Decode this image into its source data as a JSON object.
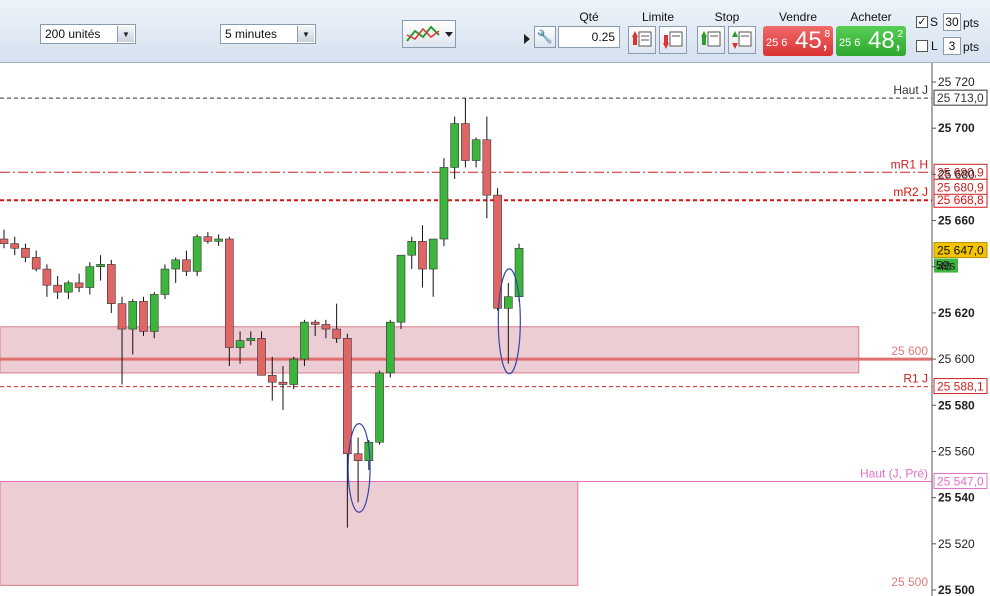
{
  "toolbar": {
    "units_select": "200 unités",
    "timeframe_select": "5 minutes",
    "qty_label": "Qté",
    "qty_value": "0.25",
    "limit_label": "Limite",
    "stop_label": "Stop",
    "sell_label": "Vendre",
    "buy_label": "Acheter",
    "sell_price_prefix": "25 6",
    "sell_price_main": "45,",
    "sell_price_sup": "8",
    "buy_price_prefix": "25 6",
    "buy_price_main": "48,",
    "buy_price_sup": "2",
    "stop_check_label": "S",
    "stop_pts_value": "30",
    "limit_check_label": "L",
    "limit_pts_value": "3",
    "pts_label": "pts"
  },
  "chart_data": {
    "type": "candlestick",
    "ylim": [
      25494,
      25730
    ],
    "yticks": [
      25720,
      25700,
      25680,
      25660,
      25640,
      25620,
      25600,
      25580,
      25560,
      25540,
      25520,
      25500
    ],
    "ytick_labels": [
      "25 720",
      "25 700",
      "25 680",
      "25 660",
      "40",
      "25 620",
      "25 600",
      "25 580",
      "25 560",
      "25 540",
      "25 520",
      "25 500"
    ],
    "candles": [
      [
        25652,
        25656,
        25648,
        25650
      ],
      [
        25650,
        25653,
        25645,
        25648
      ],
      [
        25648,
        25650,
        25642,
        25644
      ],
      [
        25644,
        25647,
        25638,
        25639
      ],
      [
        25639,
        25641,
        25627,
        25632
      ],
      [
        25632,
        25636,
        25626,
        25629
      ],
      [
        25629,
        25634,
        25626,
        25633
      ],
      [
        25633,
        25637,
        25629,
        25631
      ],
      [
        25631,
        25642,
        25628,
        25640
      ],
      [
        25640,
        25645,
        25634,
        25641
      ],
      [
        25641,
        25643,
        25620,
        25624
      ],
      [
        25624,
        25627,
        25589,
        25613
      ],
      [
        25613,
        25626,
        25602,
        25625
      ],
      [
        25625,
        25627,
        25610,
        25612
      ],
      [
        25612,
        25629,
        25609,
        25628
      ],
      [
        25628,
        25641,
        25626,
        25639
      ],
      [
        25639,
        25644,
        25633,
        25643
      ],
      [
        25643,
        25647,
        25636,
        25638
      ],
      [
        25638,
        25654,
        25636,
        25653
      ],
      [
        25653,
        25655,
        25650,
        25651
      ],
      [
        25651,
        25654,
        25649,
        25652
      ],
      [
        25652,
        25653,
        25597,
        25605
      ],
      [
        25605,
        25612,
        25598,
        25608
      ],
      [
        25608,
        25612,
        25606,
        25609
      ],
      [
        25609,
        25612,
        25593,
        25593
      ],
      [
        25593,
        25601,
        25582,
        25590
      ],
      [
        25590,
        25597,
        25578,
        25589
      ],
      [
        25589,
        25601,
        25587,
        25600
      ],
      [
        25600,
        25617,
        25597,
        25616
      ],
      [
        25616,
        25617,
        25610,
        25615
      ],
      [
        25615,
        25617,
        25609,
        25613
      ],
      [
        25613,
        25624,
        25607,
        25609
      ],
      [
        25609,
        25611,
        25527,
        25559
      ],
      [
        25559,
        25566,
        25538,
        25556
      ],
      [
        25556,
        25565,
        25552,
        25564
      ],
      [
        25564,
        25595,
        25563,
        25594
      ],
      [
        25594,
        25617,
        25592,
        25616
      ],
      [
        25616,
        25645,
        25613,
        25645
      ],
      [
        25645,
        25653,
        25639,
        25651
      ],
      [
        25651,
        25658,
        25631,
        25639
      ],
      [
        25639,
        25652,
        25627,
        25652
      ],
      [
        25652,
        25687,
        25649,
        25683
      ],
      [
        25683,
        25705,
        25678,
        25702
      ],
      [
        25702,
        25713,
        25683,
        25686
      ],
      [
        25686,
        25696,
        25683,
        25695
      ],
      [
        25695,
        25705,
        25661,
        25671
      ],
      [
        25671,
        25674,
        25621,
        25622
      ],
      [
        25622,
        25633,
        25598,
        25627
      ],
      [
        25627,
        25650,
        25625,
        25648
      ]
    ],
    "levels": [
      {
        "name": "Haut J",
        "value": 25713.0,
        "label": "25 713,0",
        "style": "dashed",
        "color": "#333333"
      },
      {
        "name": "mR1 H",
        "value": 25680.9,
        "label": "25 680,9",
        "style": "dashdot",
        "color": "#cc2222"
      },
      {
        "name": "mR2 J",
        "value": 25668.8,
        "label": "25 668,8",
        "style": "dashed",
        "color": "#dd1111"
      },
      {
        "name": "25 600",
        "value": 25600,
        "label": "",
        "style": "solid",
        "color": "#e07070"
      },
      {
        "name": "R1 J",
        "value": 25588.1,
        "label": "25 588,1",
        "style": "dashed",
        "color": "#cc2222"
      },
      {
        "name": "Haut (J, Pré)",
        "value": 25547.0,
        "label": "25 547,0",
        "style": "solid",
        "color": "#e070c8"
      }
    ],
    "extra_price_tag": "25 680,9",
    "current_price": {
      "value": 25647.0,
      "label": "25 647,0",
      "timer": "59s"
    },
    "zones": [
      {
        "from": 25594,
        "to": 25614,
        "x_end_fraction": 0.9
      },
      {
        "from": 25502,
        "to": 25547,
        "x_end_fraction": 0.62
      }
    ],
    "zone_label_upper": "25 600",
    "zone_label_lower": "25 500",
    "highlight_ellipses_at_candles": [
      33,
      47
    ],
    "colors": {
      "up": "#3db53d",
      "down": "#e06666",
      "grid": "#d0d0d0"
    }
  }
}
